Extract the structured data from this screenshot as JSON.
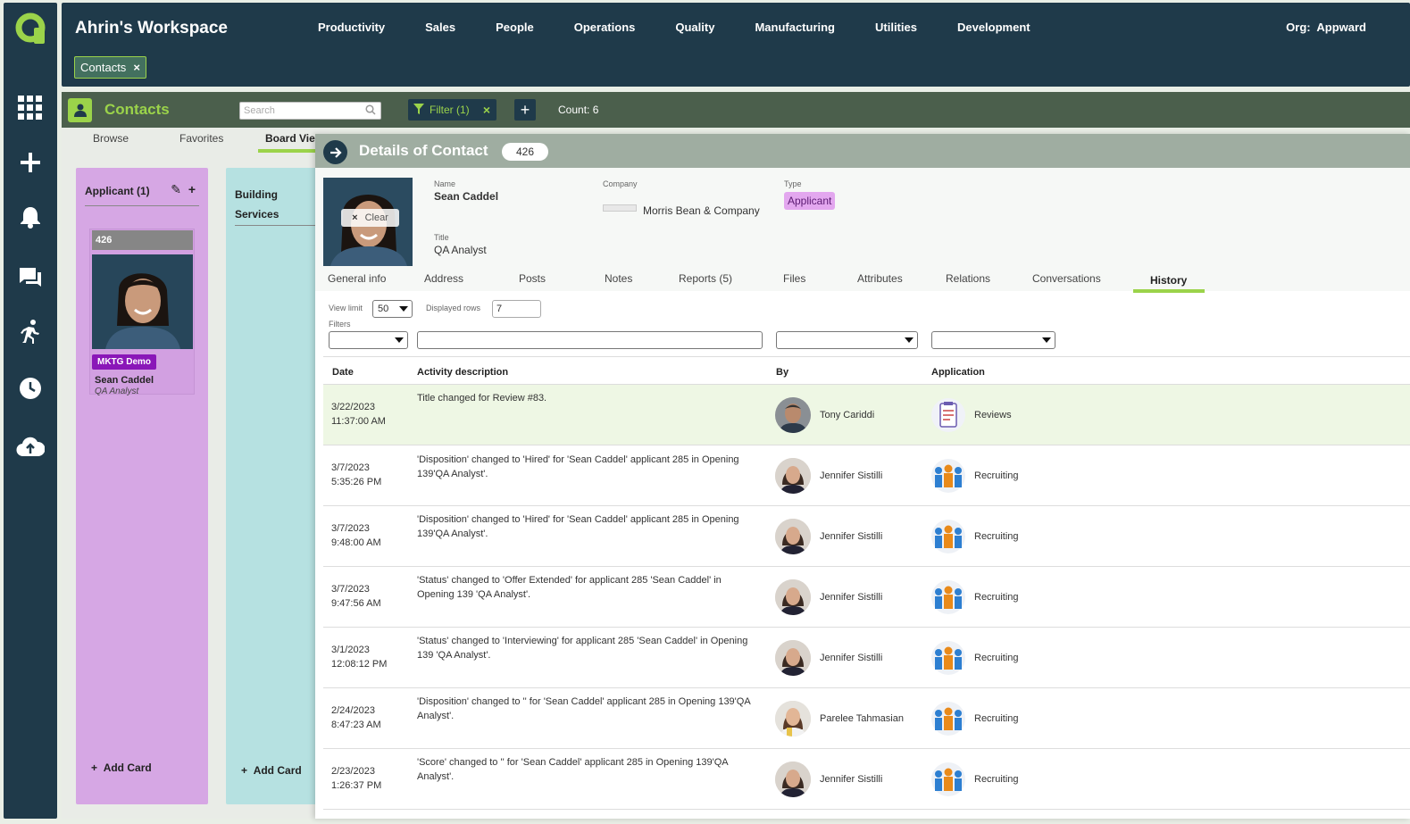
{
  "workspace_title": "Ahrin's Workspace",
  "top_nav": [
    "Productivity",
    "Sales",
    "People",
    "Operations",
    "Quality",
    "Manufacturing",
    "Utilities",
    "Development"
  ],
  "org_label": "Org:",
  "org_value": "Appward",
  "open_chip": {
    "label": "Contacts",
    "close": "×"
  },
  "rail_icons": [
    "apps-grid-icon",
    "plus-icon",
    "bell-icon",
    "chat-icon",
    "run-icon",
    "clock-icon",
    "cloud-upload-icon"
  ],
  "contacts_bar": {
    "title": "Contacts",
    "search_placeholder": "Search",
    "filter_label": "Filter (1)",
    "filter_close": "×",
    "add": "+",
    "count": "Count: 6"
  },
  "view_tabs": [
    "Browse",
    "Favorites",
    "Board Vie"
  ],
  "board": {
    "col1": {
      "title": "Applicant (1)",
      "add_label": "Add Card"
    },
    "card": {
      "id": "426",
      "tag": "MKTG Demo",
      "name": "Sean Caddel",
      "title": "QA Analyst"
    },
    "col2": {
      "title_line1": "Building",
      "title_line2": "Services",
      "add_label": "Add Card"
    }
  },
  "detail": {
    "title": "Details of Contact",
    "id": "426",
    "clear_label": "Clear",
    "name_label": "Name",
    "name_value": "Sean Caddel",
    "company_label": "Company",
    "company_value": "Morris Bean & Company",
    "type_label": "Type",
    "type_value": "Applicant",
    "title_label": "Title",
    "title_value": "QA Analyst",
    "tabs": [
      "General info",
      "Address",
      "Posts",
      "Notes",
      "Reports (5)",
      "Files",
      "Attributes",
      "Relations",
      "Conversations",
      "History"
    ],
    "active_tab": "History",
    "view_limit_label": "View limit",
    "view_limit_value": "50",
    "displayed_rows_label": "Displayed rows",
    "displayed_rows_value": "7",
    "filters_label": "Filters"
  },
  "history": {
    "columns": [
      "Date",
      "Activity description",
      "By",
      "Application"
    ],
    "rows": [
      {
        "date": "3/22/2023",
        "time": "11:37:00 AM",
        "desc": "Title changed for Review #83.",
        "by": "Tony Cariddi",
        "app": "Reviews"
      },
      {
        "date": "3/7/2023",
        "time": "5:35:26 PM",
        "desc": " 'Disposition' changed to 'Hired' for 'Sean Caddel' applicant 285 in Opening 139'QA Analyst'.",
        "by": "Jennifer Sistilli",
        "app": "Recruiting"
      },
      {
        "date": "3/7/2023",
        "time": "9:48:00 AM",
        "desc": " 'Disposition' changed to 'Hired' for 'Sean Caddel' applicant 285 in Opening 139'QA Analyst'.",
        "by": "Jennifer Sistilli",
        "app": "Recruiting"
      },
      {
        "date": "3/7/2023",
        "time": "9:47:56 AM",
        "desc": " 'Status' changed to 'Offer Extended' for  applicant 285 'Sean Caddel' in Opening 139 'QA Analyst'.",
        "by": "Jennifer Sistilli",
        "app": "Recruiting"
      },
      {
        "date": "3/1/2023",
        "time": "12:08:12 PM",
        "desc": " 'Status' changed to 'Interviewing' for  applicant 285 'Sean Caddel' in Opening 139 'QA Analyst'.",
        "by": "Jennifer Sistilli",
        "app": "Recruiting"
      },
      {
        "date": "2/24/2023",
        "time": "8:47:23 AM",
        "desc": " 'Disposition' changed to '' for 'Sean Caddel' applicant 285 in Opening 139'QA Analyst'.",
        "by": "Parelee Tahmasian",
        "app": "Recruiting"
      },
      {
        "date": "2/23/2023",
        "time": "1:26:37 PM",
        "desc": " 'Score' changed to '' for 'Sean Caddel' applicant 285 in Opening 139'QA Analyst'.",
        "by": "Jennifer Sistilli",
        "app": "Recruiting"
      }
    ]
  },
  "colors": {
    "navy": "#1f3a4a",
    "lime": "#9bd34a",
    "applicant_col": "#d6a7e4",
    "services_col": "#b6e1e1"
  }
}
